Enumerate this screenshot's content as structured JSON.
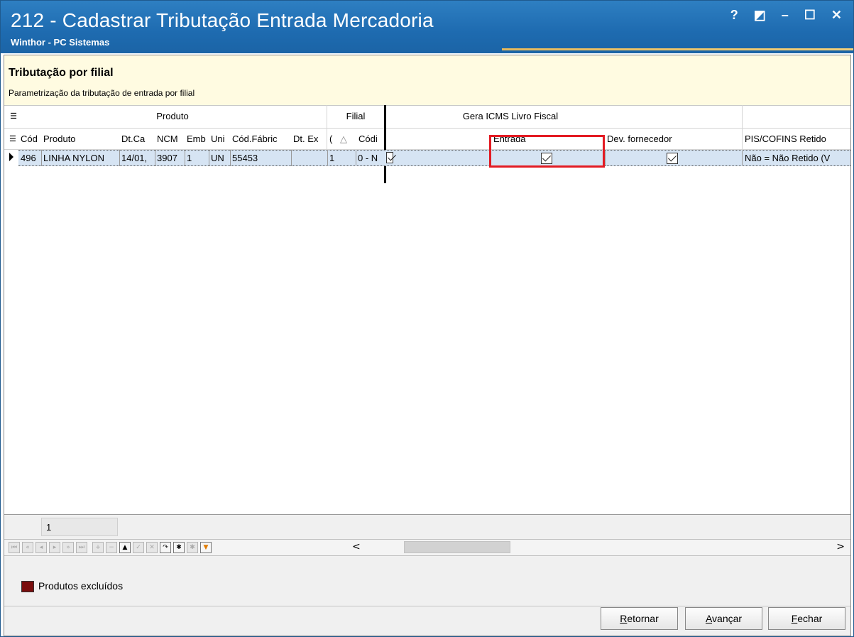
{
  "window": {
    "title": "212 - Cadastrar Tributação Entrada Mercadoria",
    "subtitle": "Winthor - PC Sistemas",
    "controls": {
      "help": "?",
      "restore": "◩",
      "minimize": "–",
      "maximize": "☐",
      "close": "✕"
    }
  },
  "banner": {
    "heading": "Tributação por filial",
    "description": "Parametrização da tributação de entrada por filial"
  },
  "grid": {
    "bands": {
      "produto": "Produto",
      "filial": "Filial",
      "gera_icms": "Gera ICMS Livro Fiscal"
    },
    "headers": {
      "cod": "Cód",
      "produto": "Produto",
      "dtcad": "Dt.Ca",
      "ncm": "NCM",
      "emb": "Emb",
      "uni": "Uni",
      "codfab": "Cód.Fábric",
      "dtex": "Dt. Ex",
      "c": "(",
      "sort": "△",
      "codi": "Códi",
      "entrada": "Entrada",
      "dev": "Dev. fornecedor",
      "pis": "PIS/COFINS Retido"
    },
    "row": {
      "cod": "496",
      "produto": "LINHA NYLON",
      "dtcad": "14/01,",
      "ncm": "3907",
      "emb": "1",
      "uni": "UN",
      "codfab": "55453",
      "dtex": "",
      "filial": "1",
      "codi": "0 - N",
      "entrada_checked": true,
      "dev_checked": true,
      "pis": "Não = Não Retido (V"
    }
  },
  "footer": {
    "record_count": "1",
    "legend_label": "Produtos excluídos",
    "legend_color": "#7a0e0e",
    "nav_icons": [
      "first-icon",
      "prev-page-icon",
      "prev-icon",
      "next-icon",
      "next-page-icon",
      "last-icon",
      "insert-icon",
      "delete-icon",
      "edit-icon",
      "post-icon",
      "cancel-icon",
      "refresh-icon",
      "asterisk-icon",
      "filter-clear-icon",
      "filter-icon"
    ],
    "scroll_left": "<",
    "scroll_right": ">"
  },
  "buttons": {
    "retornar": {
      "mnemonic": "R",
      "rest": "etornar"
    },
    "avancar": {
      "mnemonic": "A",
      "rest": "vançar"
    },
    "fechar": {
      "mnemonic": "F",
      "rest": "echar"
    }
  },
  "colors": {
    "titlebar": "#1e6bb0",
    "banner": "#fffbe1",
    "selected_row": "#d6e4f3",
    "highlight": "#e31b23"
  }
}
